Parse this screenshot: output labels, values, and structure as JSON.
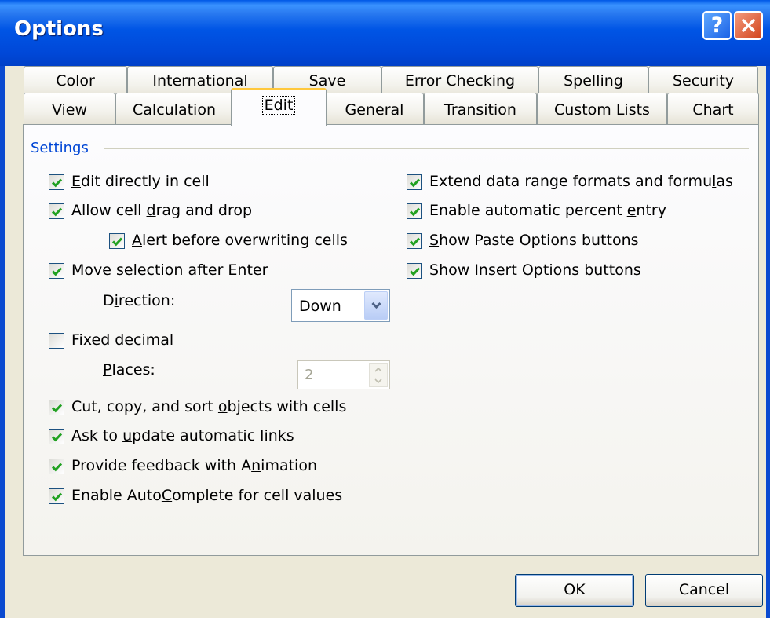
{
  "window": {
    "title": "Options"
  },
  "titlebar_buttons": {
    "help": "?",
    "close_icon": "close-x"
  },
  "tabs_row1": [
    "Color",
    "International",
    "Save",
    "Error Checking",
    "Spelling",
    "Security"
  ],
  "tabs_row2": [
    "View",
    "Calculation",
    "Edit",
    "General",
    "Transition",
    "Custom Lists",
    "Chart"
  ],
  "active_tab": "Edit",
  "settings": {
    "group_label": "Settings",
    "left": [
      {
        "pre": "",
        "u": "E",
        "post": "dit directly in cell",
        "checked": true
      },
      {
        "pre": "Allow cell ",
        "u": "d",
        "post": "rag and drop",
        "checked": true
      },
      {
        "pre": "",
        "u": "A",
        "post": "lert before overwriting cells",
        "checked": true
      },
      {
        "pre": "",
        "u": "M",
        "post": "ove selection after Enter",
        "checked": true
      },
      {
        "pre": "Fi",
        "u": "x",
        "post": "ed decimal",
        "checked": false
      },
      {
        "pre": "Cut, copy, and sort ",
        "u": "o",
        "post": "bjects with cells",
        "checked": true
      },
      {
        "pre": "Ask to ",
        "u": "u",
        "post": "pdate automatic links",
        "checked": true
      },
      {
        "pre": "Provide feedback with A",
        "u": "n",
        "post": "imation",
        "checked": true
      },
      {
        "pre": "Enable Auto",
        "u": "C",
        "post": "omplete for cell values",
        "checked": true
      }
    ],
    "right": [
      {
        "pre": "Extend data range formats and formu",
        "u": "l",
        "post": "as",
        "checked": true
      },
      {
        "pre": "Enable automatic percent ",
        "u": "e",
        "post": "ntry",
        "checked": true
      },
      {
        "pre": "",
        "u": "S",
        "post": "how Paste Options buttons",
        "checked": true
      },
      {
        "pre": "S",
        "u": "h",
        "post": "ow Insert Options buttons",
        "checked": true
      }
    ],
    "direction": {
      "pre": "D",
      "u": "i",
      "post": "rection:",
      "value": "Down"
    },
    "places": {
      "pre": "",
      "u": "P",
      "post": "laces:",
      "value": "2"
    }
  },
  "buttons": {
    "ok": "OK",
    "cancel": "Cancel"
  },
  "colors": {
    "title_blue": "#0055e5",
    "check_green": "#21a121",
    "group_label_blue": "#0046d5",
    "client_bg": "#ece9d8"
  }
}
